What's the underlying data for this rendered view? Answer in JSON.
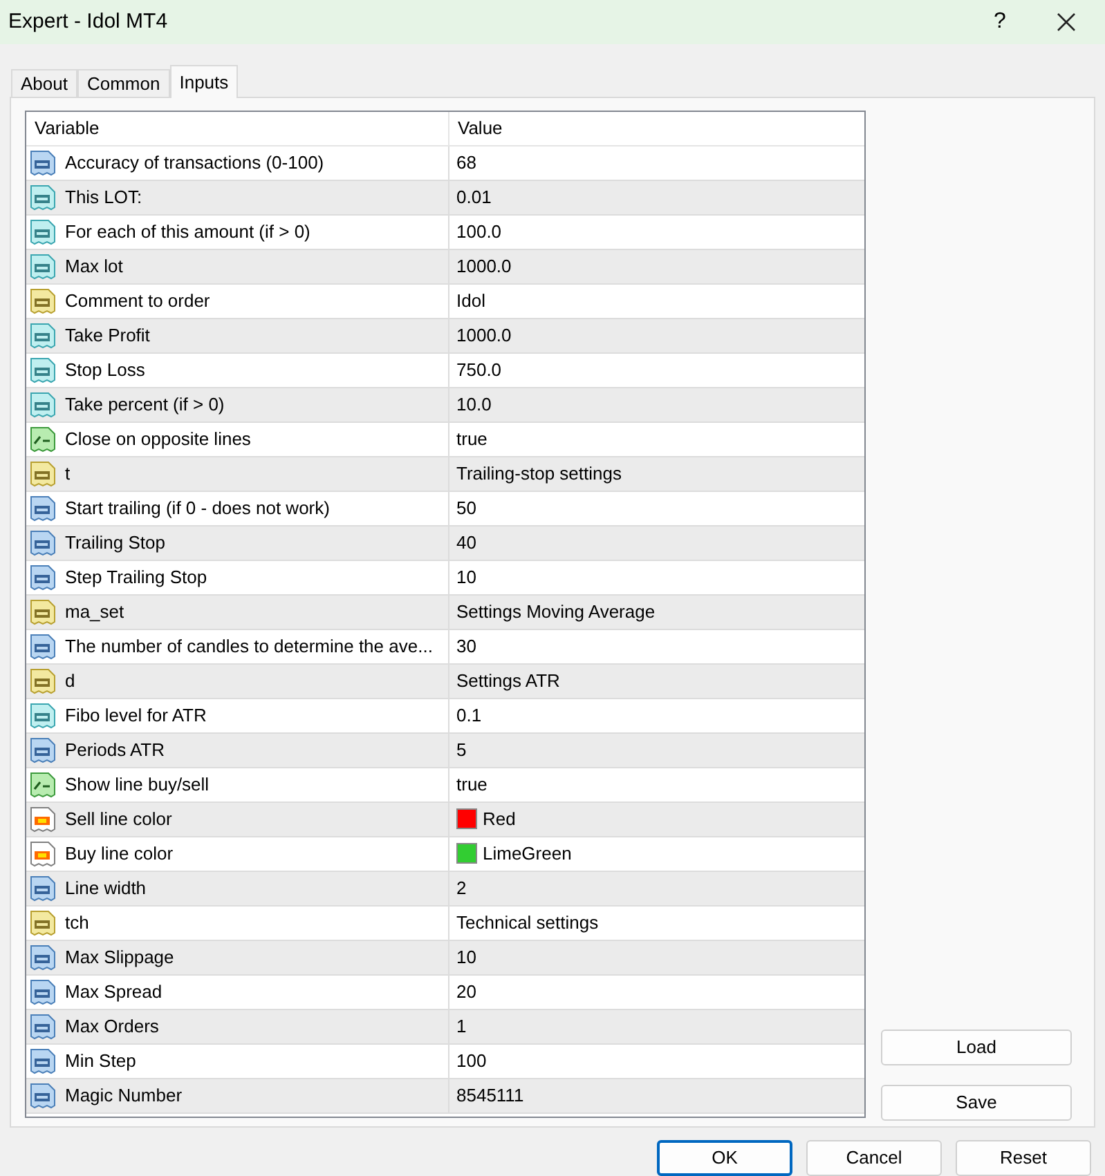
{
  "window": {
    "title": "Expert - Idol MT4",
    "help": "?"
  },
  "tabs": [
    {
      "label": "About",
      "selected": false
    },
    {
      "label": "Common",
      "selected": false
    },
    {
      "label": "Inputs",
      "selected": true
    }
  ],
  "table": {
    "columns": [
      "Variable",
      "Value"
    ],
    "rows": [
      {
        "kind": "int",
        "variable": "Accuracy of transactions (0-100)",
        "value": "68"
      },
      {
        "kind": "double",
        "variable": "This LOT:",
        "value": "0.01"
      },
      {
        "kind": "double",
        "variable": "For each of this amount (if > 0)",
        "value": "100.0"
      },
      {
        "kind": "double",
        "variable": "Max lot",
        "value": "1000.0"
      },
      {
        "kind": "string",
        "variable": "Comment to order",
        "value": "Idol"
      },
      {
        "kind": "double",
        "variable": "Take Profit",
        "value": "1000.0"
      },
      {
        "kind": "double",
        "variable": "Stop Loss",
        "value": "750.0"
      },
      {
        "kind": "double",
        "variable": "Take percent (if > 0)",
        "value": "10.0"
      },
      {
        "kind": "bool",
        "variable": "Close on opposite lines",
        "value": "true"
      },
      {
        "kind": "string",
        "variable": "t",
        "value": "Trailing-stop settings"
      },
      {
        "kind": "int",
        "variable": "Start trailing (if 0 - does not work)",
        "value": "50"
      },
      {
        "kind": "int",
        "variable": "Trailing Stop",
        "value": "40"
      },
      {
        "kind": "int",
        "variable": "Step Trailing Stop",
        "value": "10"
      },
      {
        "kind": "string",
        "variable": "ma_set",
        "value": "Settings Moving Average"
      },
      {
        "kind": "int",
        "variable": "The number of candles to determine the ave...",
        "value": "30"
      },
      {
        "kind": "string",
        "variable": "d",
        "value": "Settings ATR"
      },
      {
        "kind": "double",
        "variable": "Fibo level for ATR",
        "value": "0.1"
      },
      {
        "kind": "int",
        "variable": "Periods ATR",
        "value": "5"
      },
      {
        "kind": "bool",
        "variable": "Show line buy/sell",
        "value": "true"
      },
      {
        "kind": "color",
        "variable": "Sell line color",
        "value": "Red",
        "color": "#ff0000"
      },
      {
        "kind": "color",
        "variable": "Buy line color",
        "value": "LimeGreen",
        "color": "#32cd32"
      },
      {
        "kind": "int",
        "variable": "Line width",
        "value": "2"
      },
      {
        "kind": "string",
        "variable": "tch",
        "value": "Technical settings"
      },
      {
        "kind": "int",
        "variable": "Max Slippage",
        "value": "10"
      },
      {
        "kind": "int",
        "variable": "Max Spread",
        "value": "20"
      },
      {
        "kind": "int",
        "variable": "Max Orders",
        "value": "1"
      },
      {
        "kind": "int",
        "variable": "Min Step",
        "value": "100"
      },
      {
        "kind": "int",
        "variable": "Magic Number",
        "value": "8545111"
      }
    ]
  },
  "side_buttons": [
    "Load",
    "Save"
  ],
  "buttons": [
    {
      "label": "OK",
      "default": true
    },
    {
      "label": "Cancel",
      "default": false
    },
    {
      "label": "Reset",
      "default": false
    }
  ]
}
